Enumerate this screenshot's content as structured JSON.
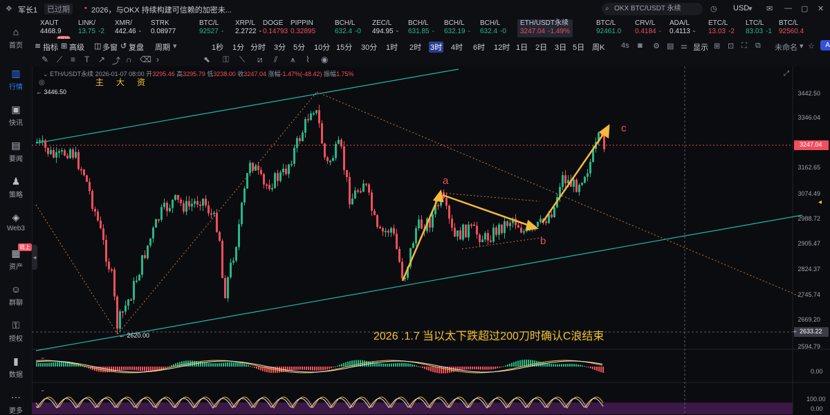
{
  "topbar": {
    "user": "军长1",
    "expired_badge": "已过期",
    "news": "2026，与OKX 持续构建可信赖的加密未...",
    "search_placeholder": "OKX BTC/USDT 永续",
    "currency": "USD"
  },
  "sidebar": {
    "items": [
      {
        "label": "首页",
        "icon": "home-icon"
      },
      {
        "label": "行情",
        "icon": "chart-bars-icon",
        "active": true
      },
      {
        "label": "快讯",
        "icon": "flash-news-icon"
      },
      {
        "label": "要闻",
        "icon": "newspaper-icon"
      },
      {
        "label": "策略",
        "icon": "strategy-icon"
      },
      {
        "label": "Web3",
        "icon": "web3-icon"
      },
      {
        "label": "资产",
        "icon": "wallet-icon",
        "badge": "链上"
      },
      {
        "label": "群聊",
        "icon": "chat-icon"
      },
      {
        "label": "授权",
        "icon": "authorize-icon"
      },
      {
        "label": "数据",
        "icon": "data-icon"
      },
      {
        "label": "更多",
        "icon": "more-icon"
      }
    ]
  },
  "ticker": [
    {
      "name": "XAUT",
      "price": "4468.9",
      "change": "",
      "color": "w",
      "badge": "NEW"
    },
    {
      "name": "LINK/",
      "price": "13.75",
      "change": "-2",
      "color": "g"
    },
    {
      "name": "XMR/",
      "price": "442.46",
      "change": "-",
      "color": "w"
    },
    {
      "name": "STRK",
      "price": "0.08977",
      "change": "",
      "color": "w"
    },
    {
      "name": "BTC/L",
      "price": "92527",
      "change": "-",
      "color": "g"
    },
    {
      "name": "XRP/L",
      "price": "2.2722",
      "change": "-",
      "color": "w"
    },
    {
      "name": "DOGE",
      "price": "0.14793",
      "change": "",
      "color": "r"
    },
    {
      "name": "PIPPIN",
      "price": "0.32895",
      "change": "",
      "color": "r"
    },
    {
      "name": "BCH/L",
      "price": "632.4",
      "change": "-0",
      "color": "g"
    },
    {
      "name": "ZEC/L",
      "price": "494.95",
      "change": "-",
      "color": "w"
    },
    {
      "name": "BCH/L",
      "price": "631.85",
      "change": "-",
      "color": "g"
    },
    {
      "name": "BCH/L",
      "price": "632.19",
      "change": "-",
      "color": "g"
    },
    {
      "name": "BCH/L",
      "price": "632.4",
      "change": "-0",
      "color": "g"
    },
    {
      "name": "ETH/USDT永续",
      "price": "3247.04",
      "change": "-1.49%",
      "color": "r",
      "active": true
    },
    {
      "name": "BTC/L",
      "price": "92461.0",
      "change": "",
      "color": "g"
    },
    {
      "name": "CRV/L",
      "price": "0.4184",
      "change": "-",
      "color": "r"
    },
    {
      "name": "ADA/L",
      "price": "0.4113",
      "change": "-",
      "color": "w"
    },
    {
      "name": "ETC/L",
      "price": "13.03",
      "change": "-2",
      "color": "r"
    },
    {
      "name": "LTC/L",
      "price": "83.03",
      "change": "-1",
      "color": "g"
    },
    {
      "name": "BTC/L",
      "price": "92560.4",
      "change": "",
      "color": "r"
    }
  ],
  "toolbar": {
    "indicators": "指标",
    "advanced": "高级",
    "multi": "多窗",
    "replay": "复盘",
    "period": "周期",
    "timeframes": [
      "1秒",
      "1分",
      "分时",
      "3分",
      "5分",
      "10分",
      "15分",
      "30分",
      "1时",
      "2时",
      "3时",
      "4时",
      "6时",
      "12时",
      "1日",
      "2日",
      "3日",
      "5日",
      "周K"
    ],
    "selected_timeframe": "3时",
    "range": "4s",
    "display": "显示",
    "unnamed": "未命名",
    "ai": "AI解读"
  },
  "chart": {
    "symbol": "ETH/USDT永续",
    "timestamp": "2026-01-07 08:00",
    "open_label": "开",
    "open": "3295.46",
    "high_label": "高",
    "high": "3295.79",
    "low_label": "低",
    "low": "3238.00",
    "close_label": "收",
    "close": "3247.04",
    "change_label": "涨幅",
    "change": "-1.47%(-48.42)",
    "amp_label": "振幅",
    "amp": "1.75%",
    "main_markers": [
      "主",
      "大",
      "资"
    ],
    "price_axis": [
      "3442.50",
      "3346.04",
      "3247.04",
      "3162.65",
      "3074.49",
      "2988.72",
      "2905.47",
      "2824.37",
      "2745.74",
      "2669.20",
      "2633.22",
      "2594.79"
    ],
    "current_price": "3247.04",
    "cursor_price": "2633.22",
    "high_marker": "3446.50",
    "low_marker": "2620.00",
    "wave_labels": {
      "a": "a",
      "b": "b",
      "c": "c"
    },
    "annotation": "2026 .1.7 当以太下跌超过200刀时确认C浪结束",
    "macd_axis": "0.00",
    "rsi_axis_top": "100.00",
    "rsi_axis_bottom": "0.00"
  },
  "colors": {
    "up": "#25b88a",
    "down": "#f04e5e",
    "accent": "#2f7df6",
    "arrow": "#f6b93b",
    "channel": "#1fb9a8"
  }
}
